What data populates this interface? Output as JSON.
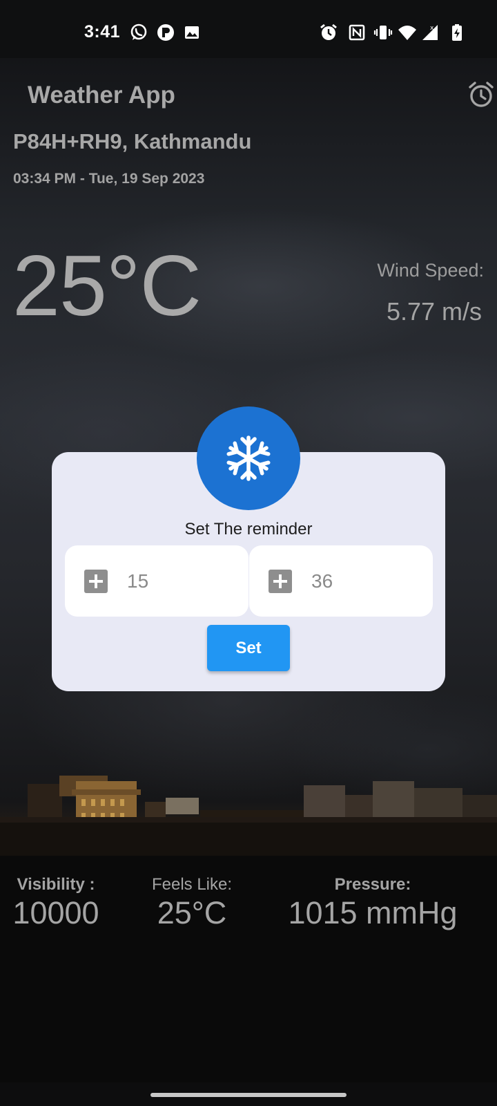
{
  "status_bar": {
    "time": "3:41",
    "left_icons": [
      "whatsapp-icon",
      "notification-app-icon",
      "gallery-icon"
    ],
    "right_icons": [
      "alarm-icon",
      "nfc-icon",
      "vibrate-icon",
      "wifi-icon",
      "cell-signal-icon",
      "battery-charging-icon"
    ]
  },
  "app_bar": {
    "title": "Weather App",
    "alarm_icon": "alarm-clock-icon"
  },
  "location": "P84H+RH9, Kathmandu",
  "datetime": "03:34 PM - Tue, 19 Sep 2023",
  "temperature": "25°C",
  "wind": {
    "label": "Wind Speed:",
    "value": "5.77 m/s"
  },
  "reminder_dialog": {
    "badge_icon": "snowflake-icon",
    "title": "Set The reminder",
    "hour": {
      "icon": "plus-box-icon",
      "value": "15"
    },
    "minute": {
      "icon": "plus-box-icon",
      "value": "36"
    },
    "set_label": "Set"
  },
  "stats": {
    "visibility": {
      "label": "Visibility :",
      "value": "10000"
    },
    "feels_like": {
      "label": "Feels Like:",
      "value": "25°C"
    },
    "pressure": {
      "label": "Pressure:",
      "value": "1015 mmHg"
    }
  },
  "colors": {
    "dialog_bg": "#e8e9f5",
    "badge": "#1c72d2",
    "set_button": "#2196f3",
    "text_muted": "#a8a8a8"
  }
}
